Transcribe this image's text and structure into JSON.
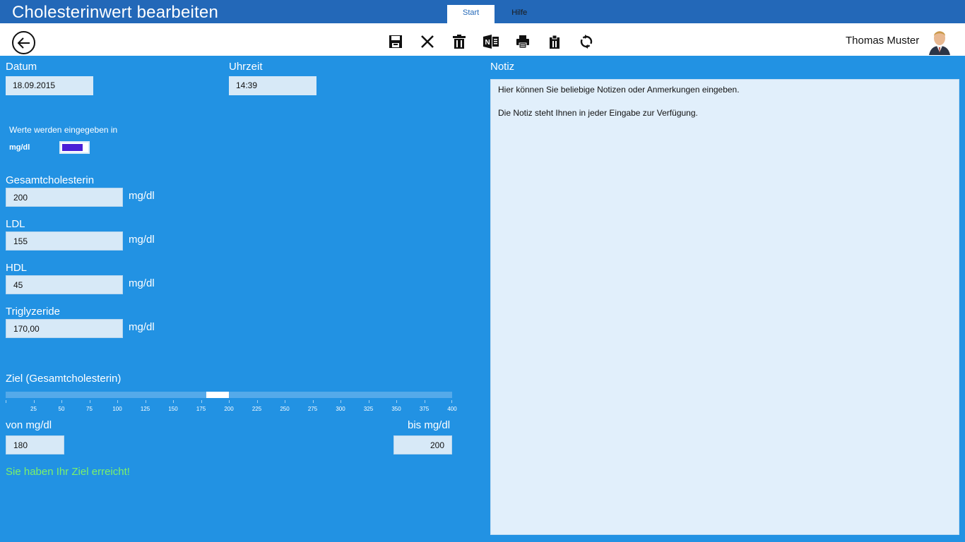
{
  "app": {
    "title": "Cholesterinwert bearbeiten",
    "tabs": [
      {
        "label": "Start",
        "active": true
      },
      {
        "label": "Hilfe",
        "active": false
      }
    ]
  },
  "toolbar": {
    "icons": [
      "back-arrow-icon",
      "save-icon",
      "close-icon",
      "delete-icon",
      "onenote-icon",
      "print-icon",
      "clipboard-icon",
      "sync-icon"
    ],
    "user_name": "Thomas Muster"
  },
  "form": {
    "date_label": "Datum",
    "date_value": "18.09.2015",
    "time_label": "Uhrzeit",
    "time_value": "14:39",
    "units_caption": "Werte werden eingegeben in",
    "units_value": "mg/dl",
    "fields": [
      {
        "label": "Gesamtcholesterin",
        "value": "200",
        "unit": "mg/dl"
      },
      {
        "label": "LDL",
        "value": "155",
        "unit": "mg/dl"
      },
      {
        "label": "HDL",
        "value": "45",
        "unit": "mg/dl"
      },
      {
        "label": "Triglyzeride",
        "value": "170,00",
        "unit": "mg/dl"
      }
    ]
  },
  "goal": {
    "label": "Ziel (Gesamtcholesterin)",
    "scale_min": 0,
    "scale_max": 400,
    "ticks": [
      "25",
      "50",
      "75",
      "100",
      "125",
      "150",
      "175",
      "200",
      "225",
      "250",
      "275",
      "300",
      "325",
      "350",
      "375",
      "400"
    ],
    "range_from": 180,
    "range_to": 200,
    "from_label": "von mg/dl",
    "from_value": "180",
    "to_label": "bis mg/dl",
    "to_value": "200",
    "status_text": "Sie haben Ihr Ziel erreicht!"
  },
  "note": {
    "label": "Notiz",
    "lines": [
      "Hier können Sie beliebige Notizen oder Anmerkungen eingeben.",
      "Die Notiz steht Ihnen in jeder Eingabe zur Verfügung."
    ]
  },
  "colors": {
    "background": "#2292e3",
    "titlebar": "#2368b8",
    "success": "#7cf06a",
    "toggle": "#4a1fd6"
  }
}
